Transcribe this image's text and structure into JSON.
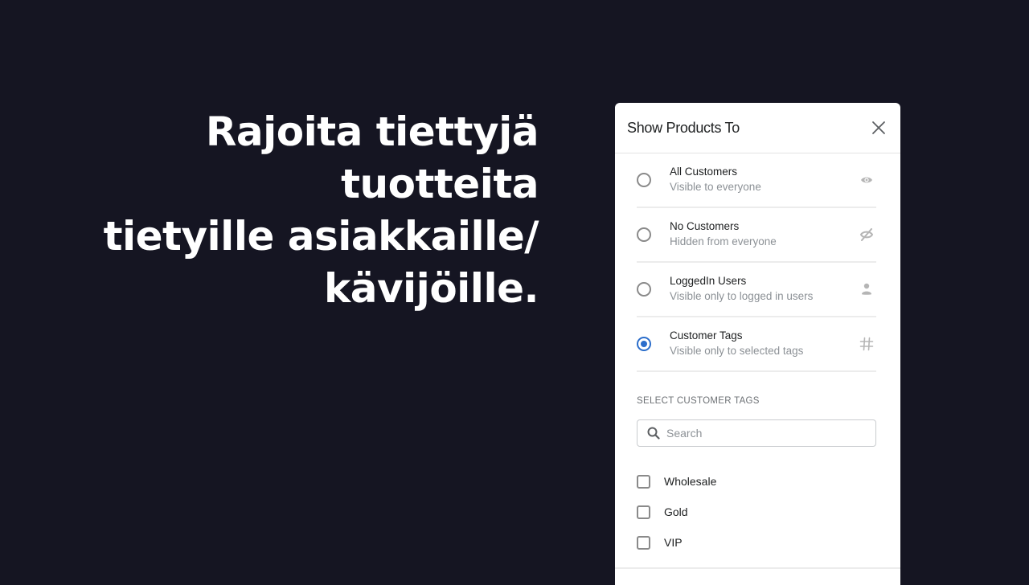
{
  "headline": {
    "lines": [
      "Rajoita tiettyjä tuotteita",
      "tietyille asiakkaille/",
      "kävijöille."
    ]
  },
  "panel": {
    "title": "Show Products To",
    "close_icon": "close-icon",
    "options": [
      {
        "title": "All Customers",
        "subtitle": "Visible to everyone",
        "icon": "eye-icon",
        "selected": false
      },
      {
        "title": "No Customers",
        "subtitle": "Hidden from everyone",
        "icon": "eye-off-icon",
        "selected": false
      },
      {
        "title": "LoggedIn Users",
        "subtitle": "Visible only to logged in users",
        "icon": "user-icon",
        "selected": false
      },
      {
        "title": "Customer Tags",
        "subtitle": "Visible only to selected tags",
        "icon": "hashtag-icon",
        "selected": true
      }
    ],
    "tags_section": {
      "label": "SELECT CUSTOMER TAGS",
      "search": {
        "placeholder": "Search",
        "value": ""
      },
      "tags": [
        {
          "label": "Wholesale",
          "checked": false
        },
        {
          "label": "Gold",
          "checked": false
        },
        {
          "label": "VIP",
          "checked": false
        }
      ]
    }
  },
  "colors": {
    "background": "#151522",
    "accent": "#2c6ecb",
    "icon_gray": "#b5b5b5"
  }
}
